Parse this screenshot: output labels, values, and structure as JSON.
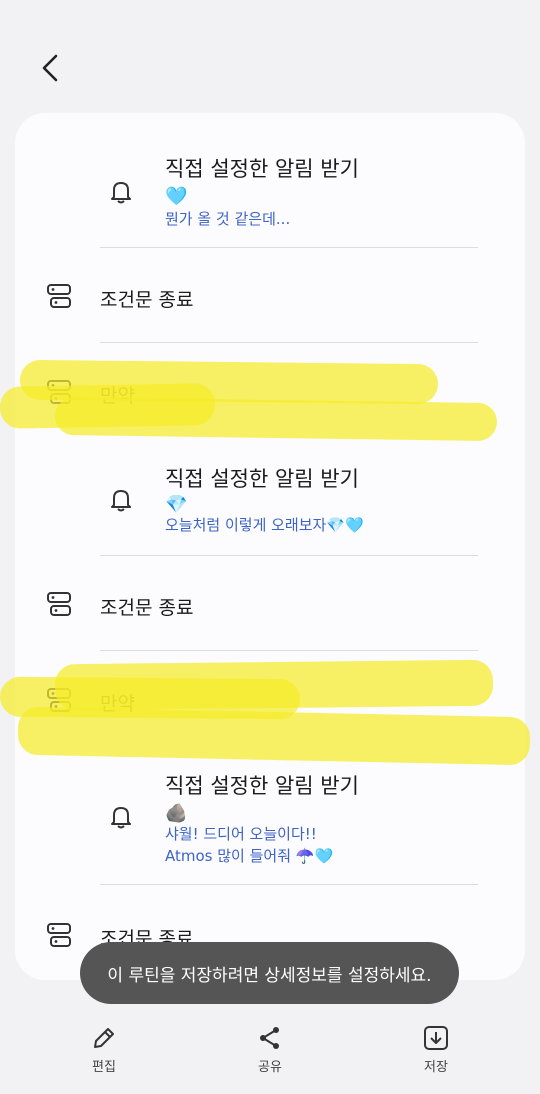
{
  "header": {
    "back_icon": "chevron-left-icon"
  },
  "items": [
    {
      "type": "notification",
      "title": "직접 설정한 알림 받기",
      "emoji": "🩵",
      "lines": [
        "뭔가 올 것 같은데..."
      ]
    },
    {
      "type": "condition-end",
      "label": "조건문 종료"
    },
    {
      "type": "if",
      "label": "만약"
    },
    {
      "type": "notification",
      "title": "직접 설정한 알림 받기",
      "emoji": "💎",
      "lines": [
        "오늘처럼 이렇게 오래보자💎🩵"
      ]
    },
    {
      "type": "condition-end",
      "label": "조건문 종료"
    },
    {
      "type": "if",
      "label": "만약"
    },
    {
      "type": "notification",
      "title": "직접 설정한 알림 받기",
      "emoji": "🪨",
      "lines": [
        "샤월! 드디어 오늘이다!!",
        "Atmos 많이 들어줘 ☂️🩵"
      ]
    },
    {
      "type": "condition-end",
      "label": "조건문 종료"
    }
  ],
  "toast": "이 루틴을 저장하려면 상세정보를 설정하세요.",
  "bottom_bar": [
    {
      "label": "편집",
      "icon": "pencil-icon"
    },
    {
      "label": "공유",
      "icon": "share-icon"
    },
    {
      "label": "저장",
      "icon": "download-icon"
    }
  ],
  "colors": {
    "highlight": "#f5ec28",
    "subtext": "#3d63c7",
    "toast_bg": "#555555"
  }
}
